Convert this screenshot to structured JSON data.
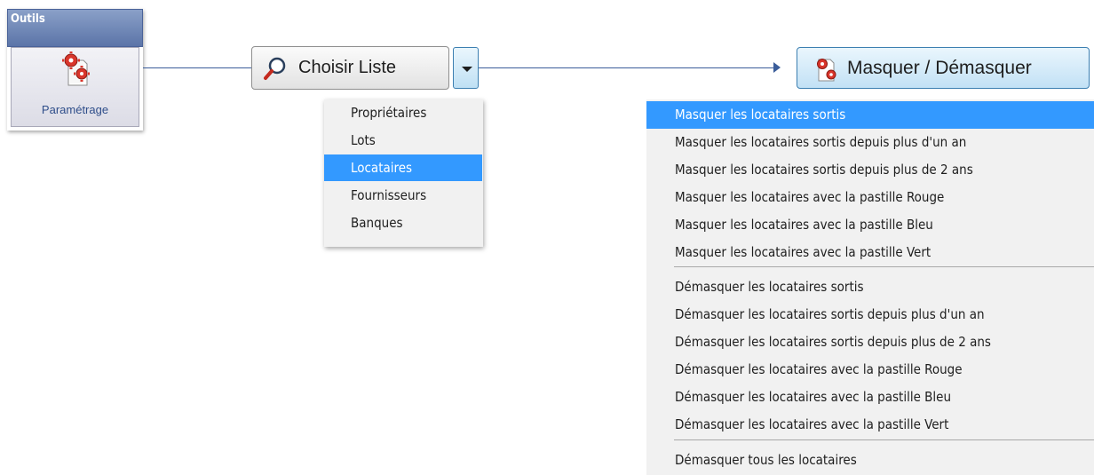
{
  "outils": {
    "title": "Outils",
    "param_label": "Paramétrage",
    "param_icon": "gears-document-icon"
  },
  "choisir": {
    "label": "Choisir Liste",
    "icon": "magnifier-icon",
    "dropdown_icon": "chevron-down-icon"
  },
  "list_menu": {
    "items": [
      "Propriétaires",
      "Lots",
      "Locataires",
      "Fournisseurs",
      "Banques"
    ],
    "selected": "Locataires"
  },
  "masquer": {
    "label": "Masquer / Démasquer",
    "icon": "gears-document-icon"
  },
  "mask_menu": {
    "items": [
      "Masquer les locataires sortis",
      "Masquer les locataires sortis depuis plus d'un an",
      "Masquer les locataires sortis depuis plus de 2 ans",
      "Masquer les locataires avec la pastille Rouge",
      "Masquer les locataires avec la pastille Bleu",
      "Masquer les locataires avec la pastille Vert",
      "Démasquer les locataires sortis",
      "Démasquer les locataires sortis depuis plus d'un an",
      "Démasquer les locataires sortis depuis plus de 2 ans",
      "Démasquer les locataires avec la pastille Rouge",
      "Démasquer les locataires avec la pastille Bleu",
      "Démasquer les locataires avec la pastille Vert",
      "Démasquer tous les locataires"
    ],
    "selected": "Masquer les locataires sortis"
  },
  "colors": {
    "header": "#5b74a8",
    "highlight": "#3399ff",
    "connector": "#3b5d9a",
    "gear_red": "#d9352b"
  }
}
